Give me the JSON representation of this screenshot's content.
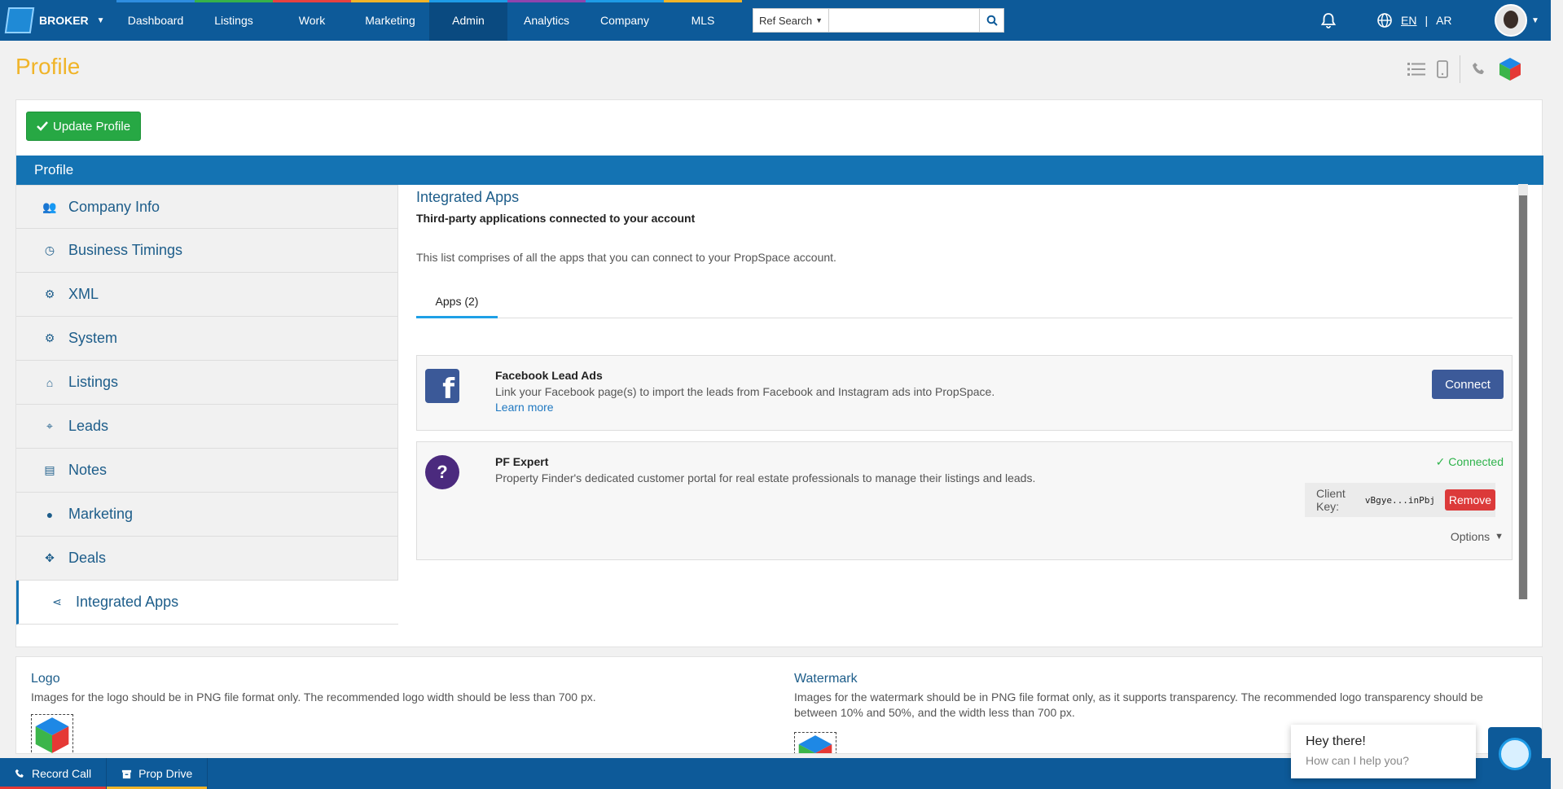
{
  "topbar": {
    "brand": "BROKER",
    "nav": [
      "Dashboard",
      "Listings",
      "Work",
      "Marketing",
      "Admin",
      "Analytics",
      "Company",
      "MLS"
    ],
    "nav_colors": [
      "#2e8de0",
      "#36b24a",
      "#e64141",
      "#f0b429",
      "#1e9be6",
      "#8e44ad",
      "#1e9be6",
      "#f0b429"
    ],
    "active_nav": "Admin",
    "ref_search_label": "Ref Search",
    "search_placeholder": "",
    "lang_en": "EN",
    "lang_sep": "|",
    "lang_ar": "AR"
  },
  "page": {
    "title": "Profile"
  },
  "actions": {
    "update_profile": "Update Profile"
  },
  "profile_bar": {
    "title": "Profile"
  },
  "sidebar": {
    "items": [
      {
        "label": "Company Info",
        "icon": "users-icon"
      },
      {
        "label": "Business Timings",
        "icon": "clock-icon"
      },
      {
        "label": "XML",
        "icon": "gear-icon"
      },
      {
        "label": "System",
        "icon": "gears-icon"
      },
      {
        "label": "Listings",
        "icon": "home-icon"
      },
      {
        "label": "Leads",
        "icon": "crosshair-icon"
      },
      {
        "label": "Notes",
        "icon": "document-icon"
      },
      {
        "label": "Marketing",
        "icon": "globe-icon"
      },
      {
        "label": "Deals",
        "icon": "handshake-icon"
      },
      {
        "label": "Integrated Apps",
        "icon": "share-icon"
      }
    ],
    "active": "Integrated Apps"
  },
  "integrated_apps": {
    "title": "Integrated Apps",
    "subtitle": "Third-party applications connected to your account",
    "description": "This list comprises of all the apps that you can connect to your PropSpace account.",
    "tab_label": "Apps (2)",
    "apps": [
      {
        "name": "Facebook Lead Ads",
        "description": "Link your Facebook page(s) to import the leads from Facebook and Instagram ads into PropSpace.",
        "link": "Learn more",
        "action": "Connect",
        "brand_color": "#3b5998"
      },
      {
        "name": "PF Expert",
        "description": "Property Finder's dedicated customer portal for real estate professionals to manage their listings and leads.",
        "status": "Connected",
        "client_key_label": "Client Key:",
        "client_key": "vBgye...inPbj",
        "remove": "Remove",
        "options": "Options",
        "brand_color": "#4b2a7e"
      }
    ]
  },
  "logo_section": {
    "title": "Logo",
    "description": "Images for the logo should be in PNG file format only. The recommended logo width should be less than 700 px."
  },
  "watermark_section": {
    "title": "Watermark",
    "description": "Images for the watermark should be in PNG file format only, as it supports transparency. The recommended logo transparency should be between 10% and 50%, and the width less than 700 px."
  },
  "footer": {
    "record_call": "Record Call",
    "prop_drive": "Prop Drive"
  },
  "chat": {
    "greeting": "Hey there!",
    "prompt": "How can I help you?"
  }
}
